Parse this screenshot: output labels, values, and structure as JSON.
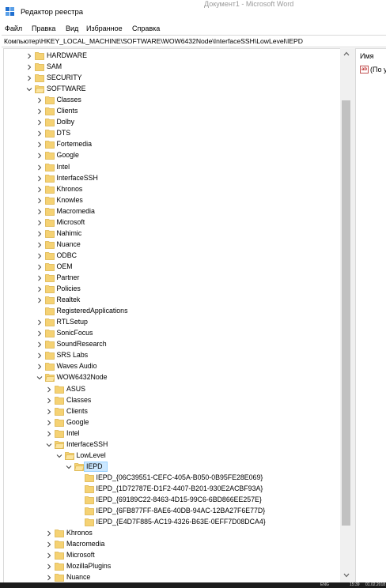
{
  "window": {
    "title": "Редактор реестра",
    "background_title": "Документ1 - Microsoft Word"
  },
  "menu": [
    "Файл",
    "Правка",
    "Вид",
    "Избранное",
    "Справка"
  ],
  "address": "Компьютер\\HKEY_LOCAL_MACHINE\\SOFTWARE\\WOW6432Node\\InterfaceSSH\\LowLevel\\IEPD",
  "tree": [
    {
      "label": "HARDWARE",
      "level": 0,
      "state": "collapsed"
    },
    {
      "label": "SAM",
      "level": 0,
      "state": "collapsed"
    },
    {
      "label": "SECURITY",
      "level": 0,
      "state": "collapsed"
    },
    {
      "label": "SOFTWARE",
      "level": 0,
      "state": "expanded"
    },
    {
      "label": "Classes",
      "level": 1,
      "state": "collapsed"
    },
    {
      "label": "Clients",
      "level": 1,
      "state": "collapsed"
    },
    {
      "label": "Dolby",
      "level": 1,
      "state": "collapsed"
    },
    {
      "label": "DTS",
      "level": 1,
      "state": "collapsed"
    },
    {
      "label": "Fortemedia",
      "level": 1,
      "state": "collapsed"
    },
    {
      "label": "Google",
      "level": 1,
      "state": "collapsed"
    },
    {
      "label": "Intel",
      "level": 1,
      "state": "collapsed"
    },
    {
      "label": "InterfaceSSH",
      "level": 1,
      "state": "collapsed"
    },
    {
      "label": "Khronos",
      "level": 1,
      "state": "collapsed"
    },
    {
      "label": "Knowles",
      "level": 1,
      "state": "collapsed"
    },
    {
      "label": "Macromedia",
      "level": 1,
      "state": "collapsed"
    },
    {
      "label": "Microsoft",
      "level": 1,
      "state": "collapsed"
    },
    {
      "label": "Nahimic",
      "level": 1,
      "state": "collapsed"
    },
    {
      "label": "Nuance",
      "level": 1,
      "state": "collapsed"
    },
    {
      "label": "ODBC",
      "level": 1,
      "state": "collapsed"
    },
    {
      "label": "OEM",
      "level": 1,
      "state": "collapsed"
    },
    {
      "label": "Partner",
      "level": 1,
      "state": "collapsed"
    },
    {
      "label": "Policies",
      "level": 1,
      "state": "collapsed"
    },
    {
      "label": "Realtek",
      "level": 1,
      "state": "collapsed"
    },
    {
      "label": "RegisteredApplications",
      "level": 1,
      "state": "leaf"
    },
    {
      "label": "RTLSetup",
      "level": 1,
      "state": "collapsed"
    },
    {
      "label": "SonicFocus",
      "level": 1,
      "state": "collapsed"
    },
    {
      "label": "SoundResearch",
      "level": 1,
      "state": "collapsed"
    },
    {
      "label": "SRS Labs",
      "level": 1,
      "state": "collapsed"
    },
    {
      "label": "Waves Audio",
      "level": 1,
      "state": "collapsed"
    },
    {
      "label": "WOW6432Node",
      "level": 1,
      "state": "expanded"
    },
    {
      "label": "ASUS",
      "level": 2,
      "state": "collapsed"
    },
    {
      "label": "Classes",
      "level": 2,
      "state": "collapsed"
    },
    {
      "label": "Clients",
      "level": 2,
      "state": "collapsed"
    },
    {
      "label": "Google",
      "level": 2,
      "state": "collapsed"
    },
    {
      "label": "Intel",
      "level": 2,
      "state": "collapsed"
    },
    {
      "label": "InterfaceSSH",
      "level": 2,
      "state": "expanded"
    },
    {
      "label": "LowLevel",
      "level": 3,
      "state": "expanded"
    },
    {
      "label": "IEPD",
      "level": 4,
      "state": "expanded",
      "selected": true
    },
    {
      "label": "IEPD_{06C39551-CEFC-405A-B050-0B95FE28E069}",
      "level": 5,
      "state": "leaf"
    },
    {
      "label": "IEPD_{1D72787E-D1F2-4407-B201-930E2ACBF93A}",
      "level": 5,
      "state": "leaf"
    },
    {
      "label": "IEPD_{69189C22-8463-4D15-99C6-6BD866EE257E}",
      "level": 5,
      "state": "leaf"
    },
    {
      "label": "IEPD_{6FB877FF-8AE6-40DB-94AC-12BA27F6E77D}",
      "level": 5,
      "state": "leaf"
    },
    {
      "label": "IEPD_{E4D7F885-AC19-4326-B63E-0EFF7D08DCA4}",
      "level": 5,
      "state": "leaf"
    },
    {
      "label": "Khronos",
      "level": 2,
      "state": "collapsed"
    },
    {
      "label": "Macromedia",
      "level": 2,
      "state": "collapsed"
    },
    {
      "label": "Microsoft",
      "level": 2,
      "state": "collapsed"
    },
    {
      "label": "MozillaPlugins",
      "level": 2,
      "state": "collapsed"
    },
    {
      "label": "Nuance",
      "level": 2,
      "state": "collapsed"
    }
  ],
  "values_pane": {
    "column_name": "Имя",
    "first_value": "(По у"
  },
  "tray": {
    "language": "ENG",
    "time": "15:39",
    "date": "01.02.2018"
  },
  "colors": {
    "folder": "#f5d274",
    "folder_dark": "#dcb44a",
    "selection": "#cce8ff",
    "icon_blue": "#1f6fd0"
  }
}
